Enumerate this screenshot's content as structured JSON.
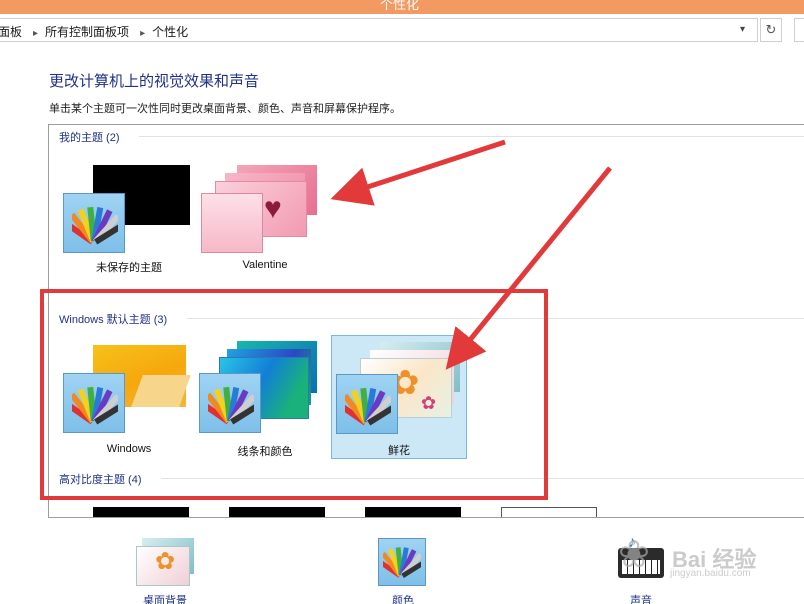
{
  "window": {
    "title": "个性化"
  },
  "address": {
    "crumbs": [
      "面板",
      "所有控制面板项",
      "个性化"
    ]
  },
  "page": {
    "heading": "更改计算机上的视觉效果和声音",
    "subheading": "单击某个主题可一次性同时更改桌面背景、颜色、声音和屏幕保护程序。"
  },
  "groups": {
    "my_themes": {
      "header": "我的主题 (2)",
      "tiles": [
        {
          "label": "未保存的主题"
        },
        {
          "label": "Valentine"
        }
      ]
    },
    "windows_default": {
      "header": "Windows 默认主题 (3)",
      "tiles": [
        {
          "label": "Windows"
        },
        {
          "label": "线条和颜色"
        },
        {
          "label": "鲜花",
          "selected": true
        }
      ]
    },
    "high_contrast": {
      "header": "高对比度主题 (4)"
    }
  },
  "bottom_bar": {
    "items": [
      {
        "label": "桌面背景"
      },
      {
        "label": "颜色"
      },
      {
        "label": "声音"
      }
    ]
  },
  "watermark": {
    "brand": "Bai 经验",
    "url": "jingyan.baidu.com"
  },
  "colors": {
    "titlebar": "#f29a62",
    "heading": "#1e3287",
    "selected_tile": "#cce8f7",
    "annotation_red": "#e23a3a"
  }
}
